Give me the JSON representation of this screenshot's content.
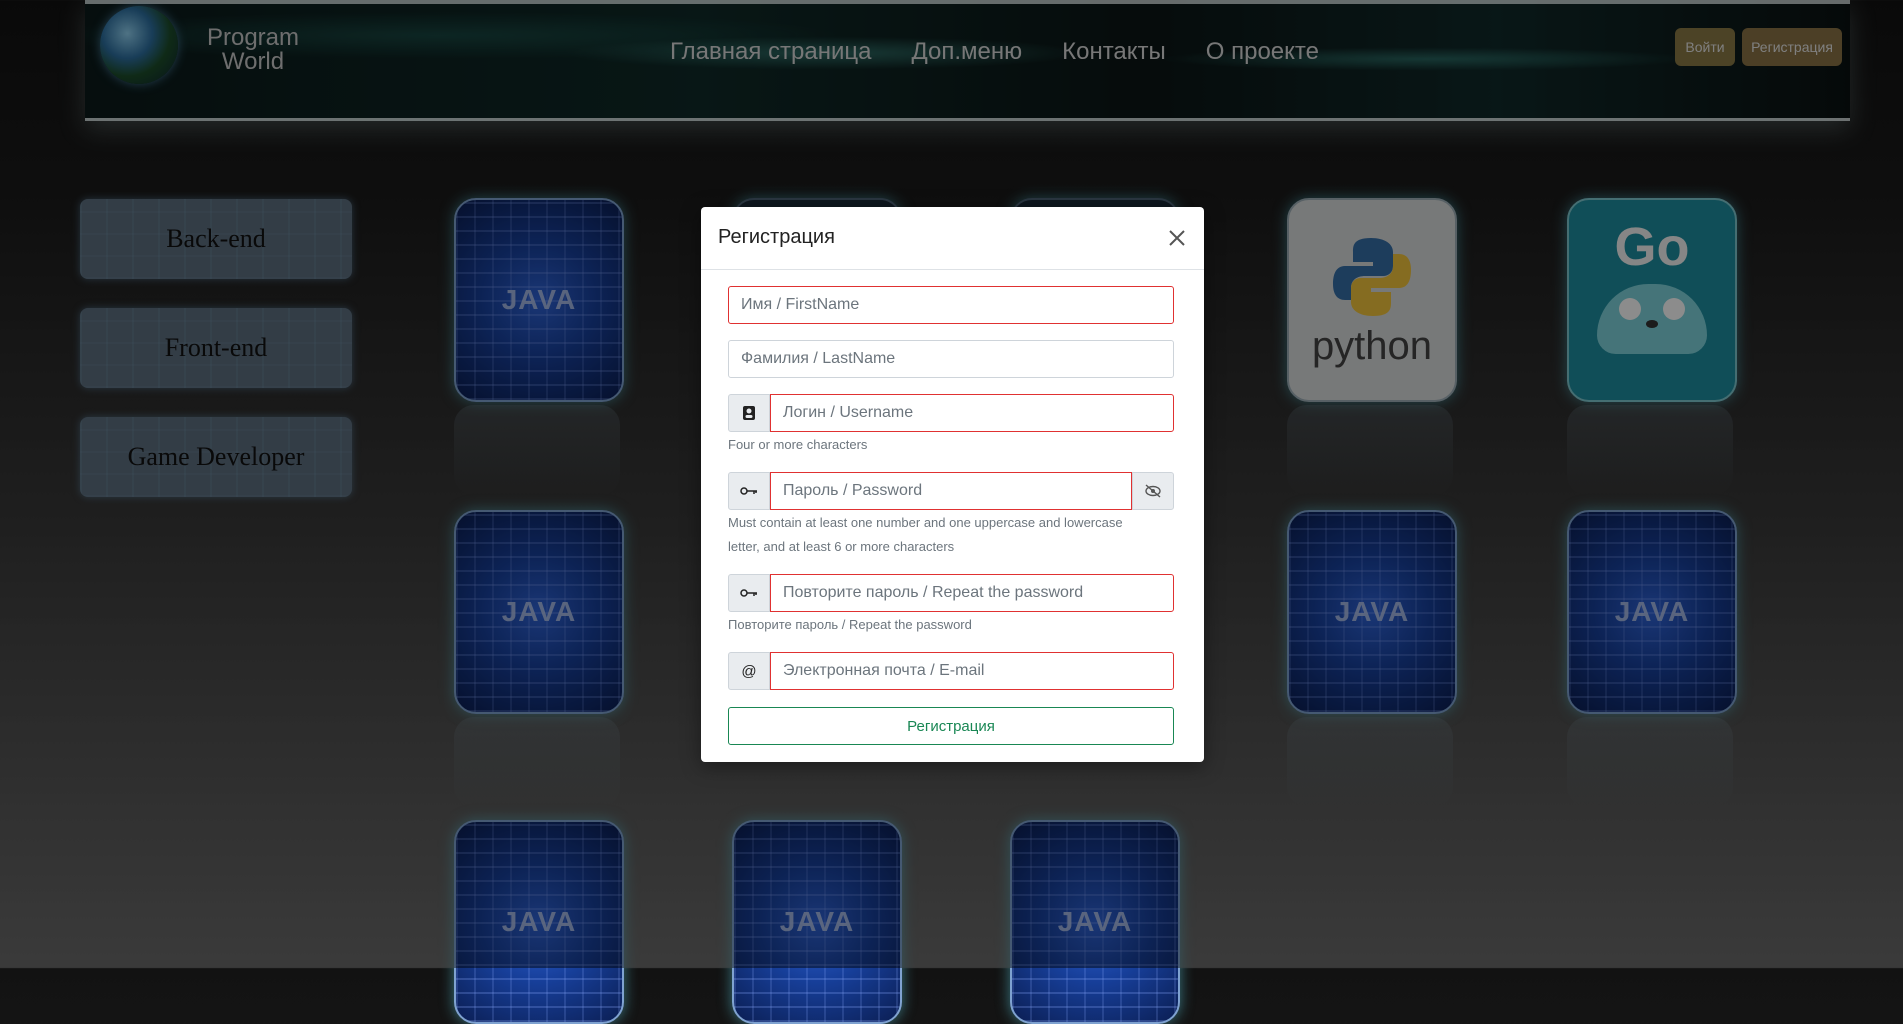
{
  "header": {
    "brand_line1": "Program",
    "brand_line2": "World",
    "nav": [
      "Главная страница",
      "Доп.меню",
      "Контакты",
      "О проекте"
    ],
    "login_label": "Войти",
    "register_label": "Регистрация"
  },
  "sidebar": {
    "items": [
      "Back-end",
      "Front-end",
      "Game Developer"
    ]
  },
  "tiles": {
    "java_text": "JAVA",
    "python_text": "python",
    "go_text": "Go"
  },
  "modal": {
    "title": "Регистрация",
    "firstname_placeholder": "Имя / FirstName",
    "lastname_placeholder": "Фамилия / LastName",
    "username_placeholder": "Логин / Username",
    "username_hint": "Four or more characters",
    "password_placeholder": "Пароль / Password",
    "password_hint_line1": "Must contain at least one number and one uppercase and lowercase",
    "password_hint_line2": "letter, and at least 6 or more characters",
    "repeat_placeholder": "Повторите пароль / Repeat the password",
    "repeat_hint": "Повторите пароль / Repeat the password",
    "email_placeholder": "Электронная почта / E-mail",
    "email_addon": "@",
    "submit_label": "Регистрация"
  },
  "colors": {
    "invalid_border": "#e03131",
    "submit_green": "#198754"
  }
}
